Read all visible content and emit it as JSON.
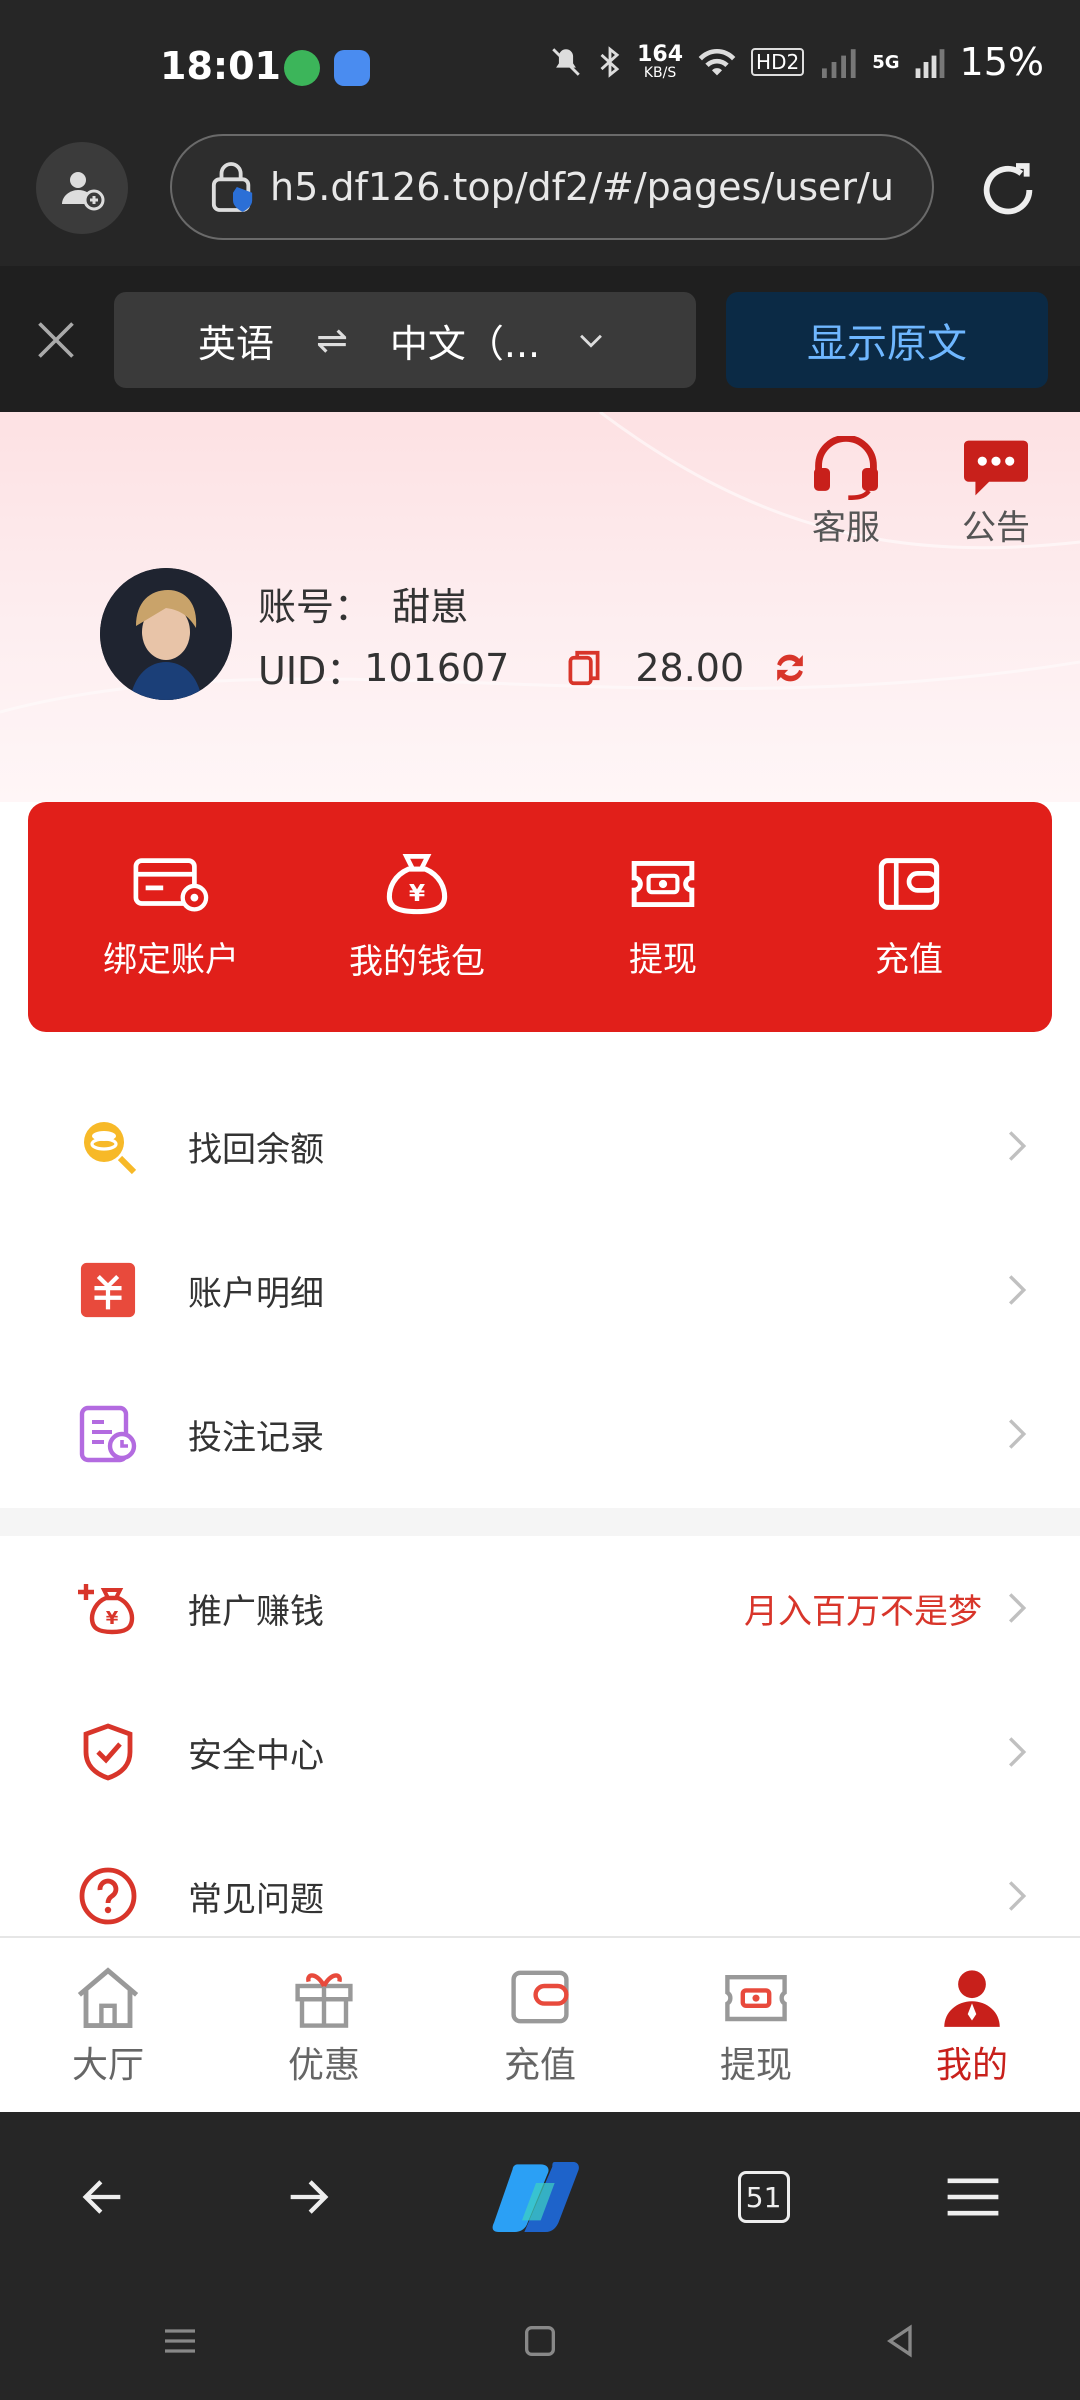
{
  "status_bar": {
    "time": "18:01",
    "net_speed_top": "164",
    "net_speed_unit": "KB/S",
    "hd_label": "HD2",
    "five_g_label": "5G",
    "battery": "15%"
  },
  "browser": {
    "url": "h5.df126.top/df2/#/pages/user/u",
    "tab_count": "51"
  },
  "translate_bar": {
    "source_lang": "英语",
    "swap_symbol": "⇌",
    "target_lang": "中文（...",
    "show_original": "显示原文"
  },
  "header": {
    "service_label": "客服",
    "notice_label": "公告",
    "account_label": "账号：",
    "account_name": "甜崽",
    "uid_label": "UID：",
    "uid_value": "101607",
    "balance": "28.00"
  },
  "card_actions": [
    {
      "label": "绑定账户"
    },
    {
      "label": "我的钱包"
    },
    {
      "label": "提现"
    },
    {
      "label": "充值"
    }
  ],
  "menu": [
    {
      "label": "找回余额",
      "extra": ""
    },
    {
      "label": "账户明细",
      "extra": ""
    },
    {
      "label": "投注记录",
      "extra": ""
    },
    {
      "label": "推广赚钱",
      "extra": "月入百万不是梦"
    },
    {
      "label": "安全中心",
      "extra": ""
    },
    {
      "label": "常见问题",
      "extra": ""
    }
  ],
  "tabs": [
    {
      "label": "大厅"
    },
    {
      "label": "优惠"
    },
    {
      "label": "充值"
    },
    {
      "label": "提现"
    },
    {
      "label": "我的"
    }
  ],
  "colors": {
    "brand_red": "#e11f1a",
    "active_tab": "#c8201b",
    "bar_dark": "#262626"
  }
}
